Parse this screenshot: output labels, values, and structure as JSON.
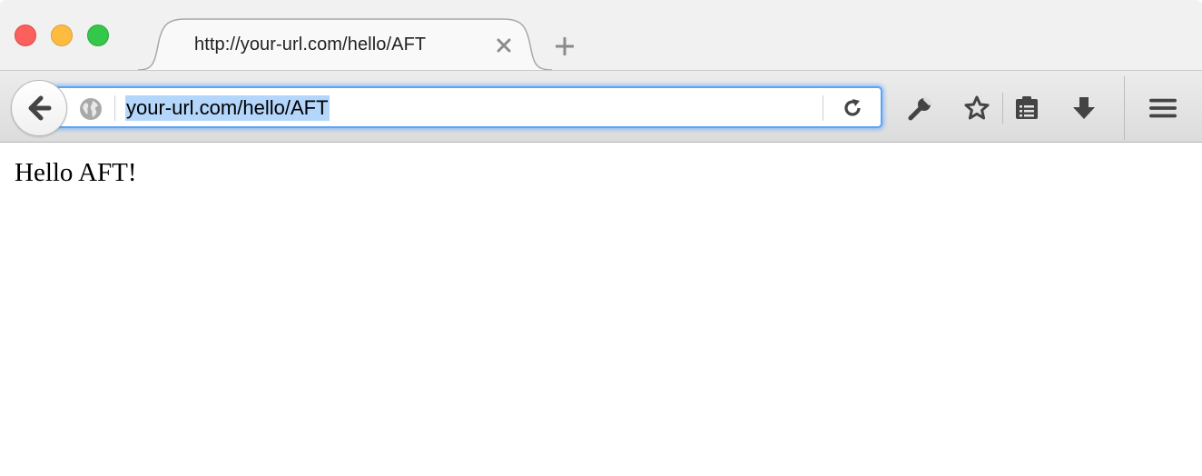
{
  "window": {
    "controls": [
      "close",
      "minimize",
      "maximize"
    ]
  },
  "tab": {
    "title": "http://your-url.com/hello/AFT",
    "close_icon": "close-icon"
  },
  "toolbar": {
    "back_icon": "back-arrow-icon",
    "site_icon": "globe-icon",
    "url": "your-url.com/hello/AFT",
    "reload_icon": "reload-icon",
    "icons": [
      "wrench-icon",
      "bookmark-star-icon",
      "reading-list-icon",
      "download-icon",
      "menu-icon"
    ]
  },
  "colors": {
    "url_focus": "#5ea4f5",
    "url_selection": "#b4d6fb",
    "close": "#fc605c",
    "minimize": "#fdbc40",
    "maximize": "#34c84a"
  },
  "page": {
    "text": "Hello AFT!"
  }
}
